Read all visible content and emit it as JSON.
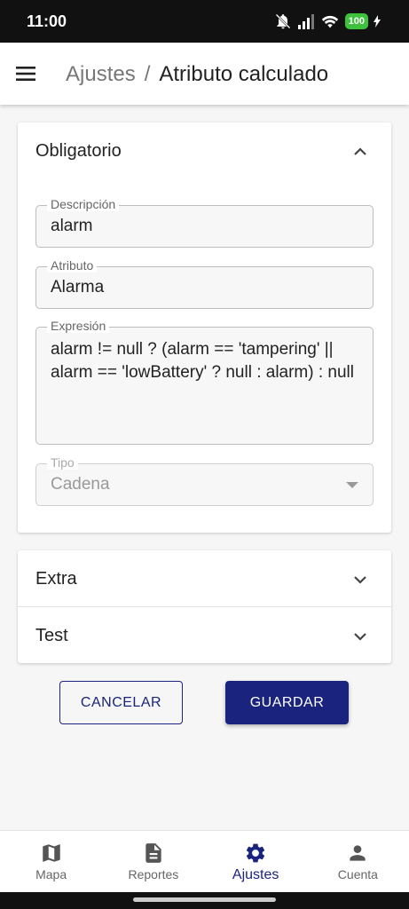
{
  "status": {
    "time": "11:00",
    "battery": "100"
  },
  "appbar": {
    "breadcrumb_parent": "Ajustes",
    "breadcrumb_separator": "/",
    "title": "Atributo calculado"
  },
  "sections": {
    "required": {
      "title": "Obligatorio",
      "expanded": true
    },
    "extra": {
      "title": "Extra",
      "expanded": false
    },
    "test": {
      "title": "Test",
      "expanded": false
    }
  },
  "form": {
    "description": {
      "label": "Descripción",
      "value": "alarm"
    },
    "attribute": {
      "label": "Atributo",
      "value": "Alarma"
    },
    "expression": {
      "label": "Expresión",
      "value": "alarm != null ? (alarm == 'tampering' || alarm == 'lowBattery' ? null : alarm) : null"
    },
    "type": {
      "label": "Tipo",
      "value": "Cadena",
      "disabled": true
    }
  },
  "actions": {
    "cancel": "CANCELAR",
    "save": "GUARDAR"
  },
  "nav": {
    "items": [
      {
        "label": "Mapa",
        "icon": "map-icon",
        "active": false
      },
      {
        "label": "Reportes",
        "icon": "document-icon",
        "active": false
      },
      {
        "label": "Ajustes",
        "icon": "gear-icon",
        "active": true
      },
      {
        "label": "Cuenta",
        "icon": "person-icon",
        "active": false
      }
    ]
  },
  "colors": {
    "primary": "#1a237e",
    "background": "#f6f6f6",
    "battery": "#3ec23e"
  }
}
